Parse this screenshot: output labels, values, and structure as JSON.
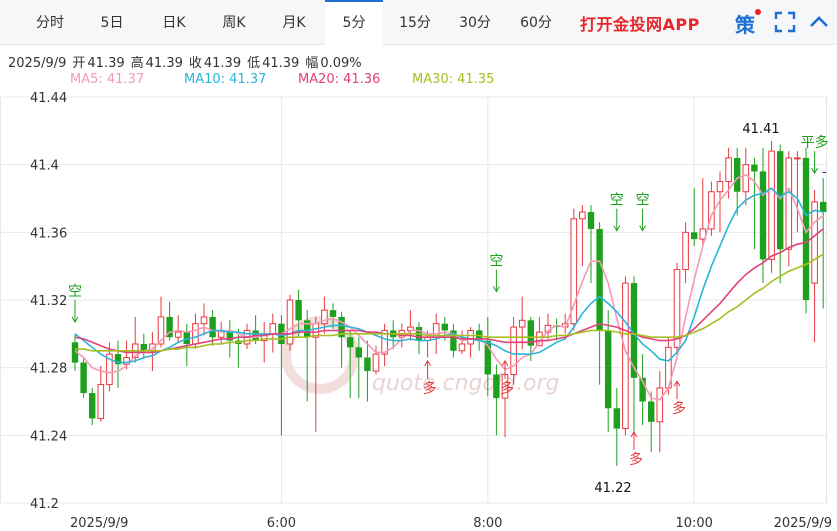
{
  "tabs": [
    {
      "label": "分时",
      "active": false
    },
    {
      "label": "5日",
      "active": false
    },
    {
      "label": "日K",
      "active": false
    },
    {
      "label": "周K",
      "active": false
    },
    {
      "label": "月K",
      "active": false
    },
    {
      "label": "5分",
      "active": true
    },
    {
      "label": "15分",
      "active": false
    },
    {
      "label": "30分",
      "active": false
    },
    {
      "label": "60分",
      "active": false
    }
  ],
  "brand": "打开金投网APP",
  "brand_color": "#e8262a",
  "icons": {
    "strategy": "策",
    "strategy_icon": "strategy-icon",
    "fullscreen_icon": "fullscreen-icon",
    "collapse_icon": "chevron-up-icon"
  },
  "info": {
    "date": "2025/9/9",
    "open_label": "开",
    "open": "41.39",
    "high_label": "高",
    "high": "41.39",
    "close_label": "收",
    "close": "41.39",
    "low_label": "低",
    "low": "41.39",
    "amp_label": "幅",
    "amp": "0.09%"
  },
  "ma_legend": [
    {
      "label": "MA5: 41.37",
      "color": "#f29bb8"
    },
    {
      "label": "MA10: 41.37",
      "color": "#2bb5d8"
    },
    {
      "label": "MA20: 41.36",
      "color": "#e0427a"
    },
    {
      "label": "MA30: 41.35",
      "color": "#a7be21"
    }
  ],
  "watermark": "quote.cngold.org",
  "chart_data": {
    "type": "candlestick",
    "y_ticks": [
      "41.44",
      "41.4",
      "41.36",
      "41.32",
      "41.28",
      "41.24",
      "41.2"
    ],
    "ylim": [
      41.2,
      41.44
    ],
    "x_ticks": [
      {
        "label": "2025/9/9",
        "index": 0
      },
      {
        "label": "6:00",
        "index": 24
      },
      {
        "label": "8:00",
        "index": 48
      },
      {
        "label": "10:00",
        "index": 72
      },
      {
        "label": "2025/9/9",
        "index": 87
      }
    ],
    "up_color": "#e8393e",
    "down_color": "#1ea01e",
    "candles": [
      [
        41.295,
        41.283,
        41.3,
        41.278
      ],
      [
        41.283,
        41.265,
        41.286,
        41.262
      ],
      [
        41.265,
        41.25,
        41.268,
        41.246
      ],
      [
        41.25,
        41.27,
        41.281,
        41.248
      ],
      [
        41.27,
        41.288,
        41.295,
        41.266
      ],
      [
        41.288,
        41.282,
        41.296,
        41.268
      ],
      [
        41.282,
        41.286,
        41.296,
        41.279
      ],
      [
        41.286,
        41.294,
        41.31,
        41.283
      ],
      [
        41.294,
        41.29,
        41.3,
        41.285
      ],
      [
        41.29,
        41.294,
        41.301,
        41.278
      ],
      [
        41.294,
        41.31,
        41.322,
        41.292
      ],
      [
        41.31,
        41.298,
        41.319,
        41.296
      ],
      [
        41.298,
        41.301,
        41.311,
        41.295
      ],
      [
        41.301,
        41.294,
        41.306,
        41.281
      ],
      [
        41.294,
        41.306,
        41.312,
        41.291
      ],
      [
        41.306,
        41.31,
        41.318,
        41.299
      ],
      [
        41.31,
        41.298,
        41.314,
        41.293
      ],
      [
        41.298,
        41.302,
        41.307,
        41.294
      ],
      [
        41.302,
        41.296,
        41.308,
        41.286
      ],
      [
        41.296,
        41.294,
        41.303,
        41.28
      ],
      [
        41.294,
        41.302,
        41.306,
        41.291
      ],
      [
        41.302,
        41.296,
        41.311,
        41.294
      ],
      [
        41.296,
        41.3,
        41.307,
        41.283
      ],
      [
        41.3,
        41.306,
        41.312,
        41.289
      ],
      [
        41.306,
        41.294,
        41.311,
        41.24
      ],
      [
        41.294,
        41.32,
        41.323,
        41.29
      ],
      [
        41.32,
        41.308,
        41.326,
        41.298
      ],
      [
        41.308,
        41.298,
        41.314,
        41.26
      ],
      [
        41.298,
        41.306,
        41.31,
        41.242
      ],
      [
        41.306,
        41.314,
        41.322,
        41.3
      ],
      [
        41.314,
        41.31,
        41.318,
        41.303
      ],
      [
        41.31,
        41.298,
        41.313,
        41.28
      ],
      [
        41.298,
        41.292,
        41.302,
        41.262
      ],
      [
        41.292,
        41.286,
        41.298,
        41.262
      ],
      [
        41.286,
        41.278,
        41.296,
        41.26
      ],
      [
        41.278,
        41.288,
        41.293,
        41.276
      ],
      [
        41.288,
        41.302,
        41.306,
        41.281
      ],
      [
        41.302,
        41.298,
        41.308,
        41.291
      ],
      [
        41.298,
        41.302,
        41.306,
        41.292
      ],
      [
        41.302,
        41.304,
        41.314,
        41.296
      ],
      [
        41.304,
        41.296,
        41.307,
        41.288
      ],
      [
        41.296,
        41.298,
        41.302,
        41.286
      ],
      [
        41.298,
        41.306,
        41.312,
        41.288
      ],
      [
        41.306,
        41.302,
        41.31,
        41.296
      ],
      [
        41.302,
        41.29,
        41.306,
        41.286
      ],
      [
        41.29,
        41.294,
        41.302,
        41.288
      ],
      [
        41.294,
        41.302,
        41.304,
        41.286
      ],
      [
        41.302,
        41.296,
        41.306,
        41.29
      ],
      [
        41.296,
        41.276,
        41.31,
        41.263
      ],
      [
        41.276,
        41.262,
        41.282,
        41.24
      ],
      [
        41.262,
        41.276,
        41.282,
        41.239
      ],
      [
        41.276,
        41.304,
        41.31,
        41.27
      ],
      [
        41.304,
        41.308,
        41.322,
        41.291
      ],
      [
        41.308,
        41.293,
        41.31,
        41.284
      ],
      [
        41.293,
        41.301,
        41.31,
        41.296
      ],
      [
        41.301,
        41.305,
        41.312,
        41.296
      ],
      [
        41.305,
        41.304,
        41.309,
        41.296
      ],
      [
        41.304,
        41.306,
        41.312,
        41.3
      ],
      [
        41.306,
        41.368,
        41.374,
        41.302
      ],
      [
        41.368,
        41.372,
        41.376,
        41.34
      ],
      [
        41.372,
        41.362,
        41.376,
        41.33
      ],
      [
        41.362,
        41.302,
        41.366,
        41.27
      ],
      [
        41.302,
        41.256,
        41.314,
        41.242
      ],
      [
        41.256,
        41.244,
        41.268,
        41.222
      ],
      [
        41.244,
        41.33,
        41.334,
        41.24
      ],
      [
        41.33,
        41.274,
        41.334,
        41.24
      ],
      [
        41.274,
        41.26,
        41.288,
        41.246
      ],
      [
        41.26,
        41.248,
        41.266,
        41.23
      ],
      [
        41.248,
        41.268,
        41.278,
        41.23
      ],
      [
        41.268,
        41.292,
        41.298,
        41.264
      ],
      [
        41.292,
        41.338,
        41.342,
        41.288
      ],
      [
        41.338,
        41.36,
        41.366,
        41.33
      ],
      [
        41.36,
        41.356,
        41.386,
        41.352
      ],
      [
        41.356,
        41.362,
        41.392,
        41.352
      ],
      [
        41.362,
        41.384,
        41.39,
        41.358
      ],
      [
        41.384,
        41.39,
        41.396,
        41.36
      ],
      [
        41.39,
        41.404,
        41.41,
        41.38
      ],
      [
        41.404,
        41.384,
        41.41,
        41.37
      ],
      [
        41.384,
        41.4,
        41.41,
        41.376
      ],
      [
        41.4,
        41.396,
        41.404,
        41.35
      ],
      [
        41.396,
        41.344,
        41.41,
        41.33
      ],
      [
        41.344,
        41.408,
        41.414,
        41.336
      ],
      [
        41.408,
        41.35,
        41.412,
        41.33
      ],
      [
        41.35,
        41.404,
        41.408,
        41.34
      ],
      [
        41.404,
        41.404,
        41.408,
        41.36
      ],
      [
        41.404,
        41.32,
        41.41,
        41.312
      ],
      [
        41.33,
        41.378,
        41.385,
        41.295
      ],
      [
        41.378,
        41.372,
        41.392,
        41.315
      ]
    ],
    "ma": {
      "MA5": [
        41.29,
        41.286,
        41.28,
        41.278,
        41.277,
        41.278,
        41.281,
        41.287,
        41.29,
        41.291,
        41.296,
        41.301,
        41.302,
        41.301,
        41.302,
        41.304,
        41.302,
        41.301,
        41.302,
        41.3,
        41.298,
        41.298,
        41.299,
        41.3,
        41.3,
        41.303,
        41.306,
        41.306,
        41.306,
        41.308,
        41.309,
        41.307,
        41.304,
        41.299,
        41.294,
        41.289,
        41.289,
        41.292,
        41.297,
        41.302,
        41.302,
        41.3,
        41.3,
        41.301,
        41.3,
        41.296,
        41.297,
        41.297,
        41.293,
        41.285,
        41.279,
        41.281,
        41.286,
        41.288,
        41.295,
        41.302,
        41.305,
        41.304,
        41.317,
        41.331,
        41.343,
        41.343,
        41.33,
        41.309,
        41.29,
        41.28,
        41.272,
        41.262,
        41.261,
        41.268,
        41.286,
        41.31,
        41.332,
        41.352,
        41.37,
        41.379,
        41.385,
        41.392,
        41.394,
        41.39,
        41.382,
        41.386,
        41.38,
        41.386,
        41.374,
        41.36,
        41.366,
        41.37
      ],
      "MA10": [
        41.3,
        41.296,
        41.292,
        41.288,
        41.285,
        41.283,
        41.283,
        41.284,
        41.286,
        41.287,
        41.29,
        41.292,
        41.295,
        41.297,
        41.298,
        41.3,
        41.302,
        41.302,
        41.301,
        41.301,
        41.3,
        41.3,
        41.3,
        41.3,
        41.299,
        41.3,
        41.302,
        41.302,
        41.303,
        41.304,
        41.305,
        41.305,
        41.304,
        41.303,
        41.301,
        41.299,
        41.297,
        41.296,
        41.296,
        41.297,
        41.296,
        41.296,
        41.297,
        41.299,
        41.3,
        41.298,
        41.297,
        41.296,
        41.295,
        41.293,
        41.29,
        41.288,
        41.288,
        41.288,
        41.289,
        41.292,
        41.295,
        41.297,
        41.304,
        41.312,
        41.318,
        41.322,
        41.318,
        41.313,
        41.307,
        41.3,
        41.294,
        41.29,
        41.285,
        41.284,
        41.289,
        41.296,
        41.31,
        41.326,
        41.34,
        41.352,
        41.364,
        41.374,
        41.379,
        41.382,
        41.383,
        41.386,
        41.381,
        41.384,
        41.38,
        41.37,
        41.373,
        41.372
      ],
      "MA20": [
        41.298,
        41.297,
        41.295,
        41.293,
        41.291,
        41.29,
        41.289,
        41.289,
        41.289,
        41.289,
        41.29,
        41.291,
        41.292,
        41.293,
        41.294,
        41.295,
        41.296,
        41.297,
        41.297,
        41.298,
        41.298,
        41.299,
        41.299,
        41.3,
        41.3,
        41.3,
        41.301,
        41.301,
        41.301,
        41.302,
        41.302,
        41.302,
        41.302,
        41.302,
        41.301,
        41.301,
        41.3,
        41.3,
        41.299,
        41.299,
        41.298,
        41.298,
        41.298,
        41.298,
        41.298,
        41.297,
        41.297,
        41.297,
        41.297,
        41.296,
        41.295,
        41.295,
        41.295,
        41.295,
        41.296,
        41.296,
        41.297,
        41.298,
        41.3,
        41.302,
        41.304,
        41.306,
        41.305,
        41.304,
        41.302,
        41.3,
        41.298,
        41.297,
        41.296,
        41.296,
        41.297,
        41.299,
        41.303,
        41.308,
        41.313,
        41.318,
        41.324,
        41.33,
        41.335,
        41.339,
        41.342,
        41.346,
        41.348,
        41.351,
        41.353,
        41.354,
        41.358,
        41.362
      ],
      "MA30": [
        41.291,
        41.291,
        41.29,
        41.29,
        41.29,
        41.29,
        41.29,
        41.29,
        41.29,
        41.29,
        41.29,
        41.291,
        41.291,
        41.292,
        41.292,
        41.293,
        41.294,
        41.294,
        41.295,
        41.295,
        41.296,
        41.296,
        41.297,
        41.297,
        41.297,
        41.298,
        41.298,
        41.298,
        41.299,
        41.299,
        41.299,
        41.3,
        41.3,
        41.3,
        41.3,
        41.3,
        41.3,
        41.3,
        41.3,
        41.3,
        41.3,
        41.299,
        41.299,
        41.299,
        41.299,
        41.299,
        41.299,
        41.299,
        41.298,
        41.298,
        41.298,
        41.298,
        41.298,
        41.298,
        41.298,
        41.298,
        41.299,
        41.299,
        41.3,
        41.301,
        41.302,
        41.302,
        41.302,
        41.301,
        41.3,
        41.3,
        41.299,
        41.298,
        41.298,
        41.298,
        41.298,
        41.299,
        41.301,
        41.303,
        41.306,
        41.309,
        41.313,
        41.316,
        41.32,
        41.324,
        41.327,
        41.331,
        41.334,
        41.337,
        41.339,
        41.341,
        41.344,
        41.347
      ]
    },
    "annotations": [
      {
        "text": "空",
        "index": 0,
        "value": 41.32,
        "dir": "down"
      },
      {
        "text": "空",
        "index": 49,
        "value": 41.338,
        "dir": "down"
      },
      {
        "text": "空",
        "index": 63,
        "value": 41.374,
        "dir": "down"
      },
      {
        "text": "空",
        "index": 66,
        "value": 41.374,
        "dir": "down"
      },
      {
        "text": "平多",
        "index": 86,
        "value": 41.408,
        "dir": "down"
      },
      {
        "text": "多",
        "index": 41,
        "value": 41.284,
        "dir": "up"
      },
      {
        "text": "多",
        "index": 50,
        "value": 41.284,
        "dir": "up"
      },
      {
        "text": "多",
        "index": 65,
        "value": 41.242,
        "dir": "up"
      },
      {
        "text": "多",
        "index": 70,
        "value": 41.272,
        "dir": "up"
      }
    ],
    "high_label": "41.41",
    "low_label": "41.22",
    "last_marker": "-"
  }
}
